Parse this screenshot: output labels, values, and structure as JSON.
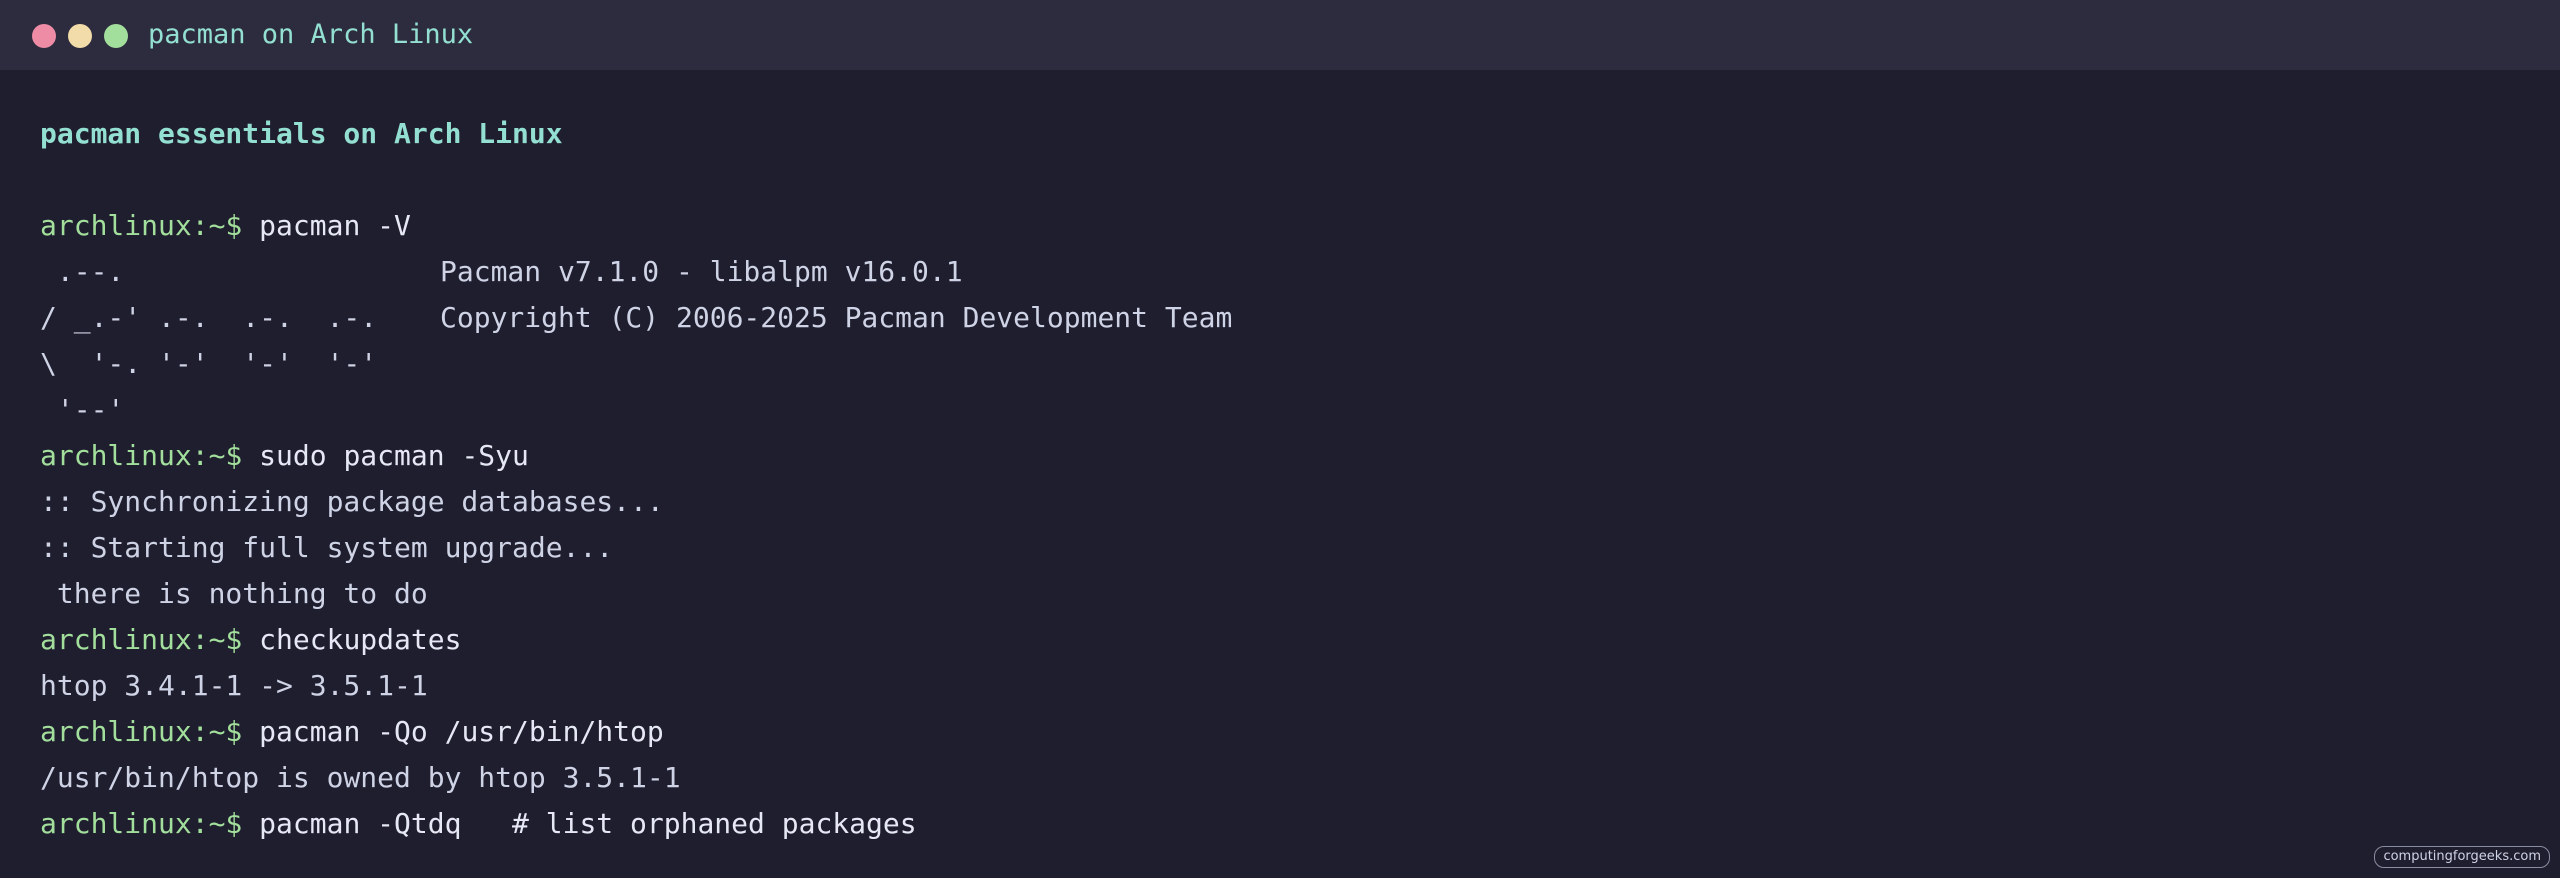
{
  "window": {
    "title": "pacman on Arch Linux",
    "controls": [
      "close",
      "minimize",
      "maximize"
    ]
  },
  "heading": "pacman essentials on Arch Linux",
  "prompt": "archlinux:~$",
  "session": {
    "cmd1": "pacman -V",
    "version_ascii": [
      " .--.",
      "/ _.-' .-.  .-.  .-.",
      "\\  '-. '-'  '-'  '-'",
      " '--'"
    ],
    "version_info": [
      "Pacman v7.1.0 - libalpm v16.0.1",
      "Copyright (C) 2006-2025 Pacman Development Team"
    ],
    "cmd2": "sudo pacman -Syu",
    "out2": [
      ":: Synchronizing package databases...",
      ":: Starting full system upgrade...",
      " there is nothing to do"
    ],
    "cmd3": "checkupdates",
    "out3": [
      "htop 3.4.1-1 -> 3.5.1-1"
    ],
    "cmd4": "pacman -Qo /usr/bin/htop",
    "out4": [
      "/usr/bin/htop is owned by htop 3.5.1-1"
    ],
    "cmd5": "pacman -Qtdq   # list orphaned packages"
  },
  "watermark": "computingforgeeks.com",
  "colors": {
    "background": "#1f1e2e",
    "titlebar": "#2d2c3e",
    "title_text": "#93e0d2",
    "prompt": "#a3df9c",
    "text": "#cfd3e6",
    "close": "#ee8ba5",
    "minimize": "#f2dcaa",
    "maximize": "#a3df9c"
  }
}
